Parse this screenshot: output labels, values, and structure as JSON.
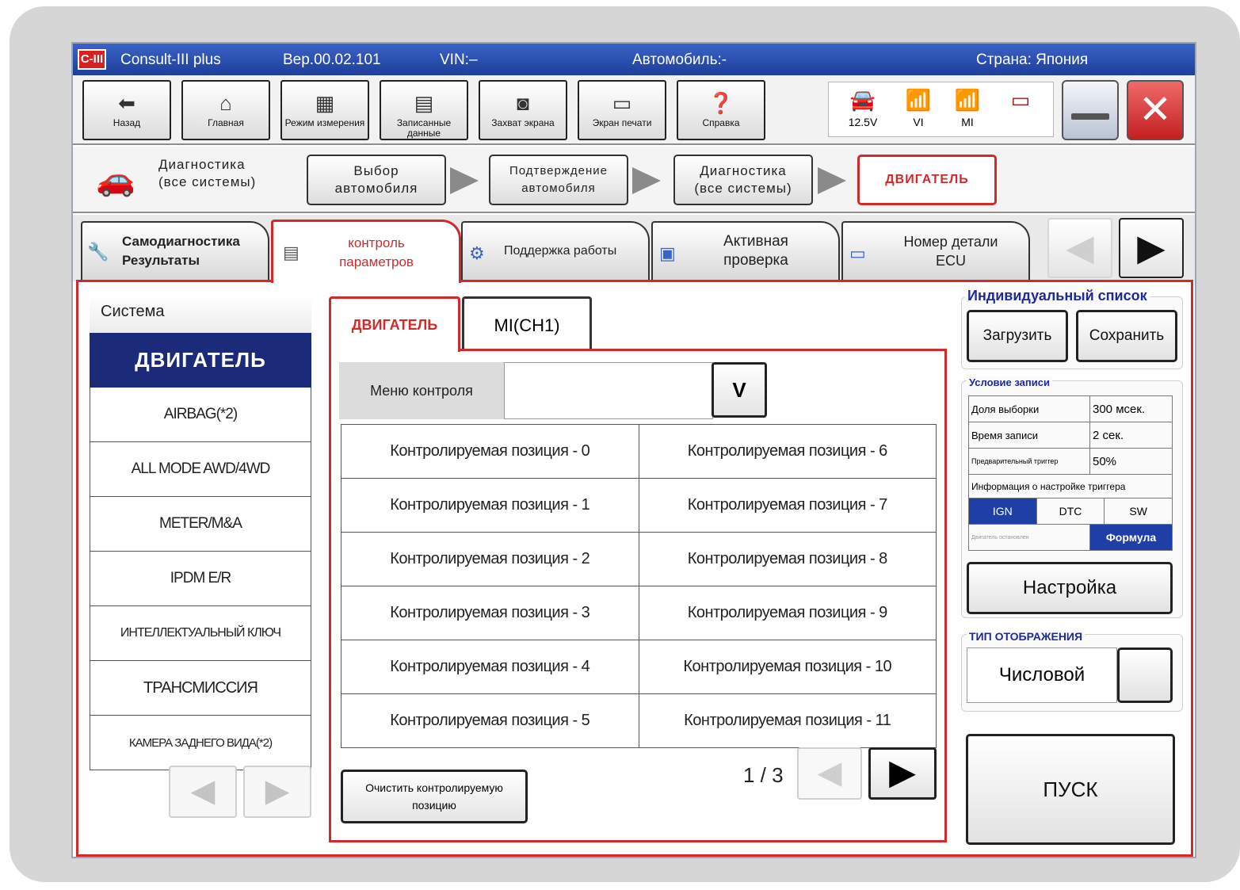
{
  "titlebar": {
    "logo": "C-III",
    "app": "Consult-III plus",
    "version": "Вер.00.02.101",
    "vin": "VIN:–",
    "vehicle": "Автомобиль:-",
    "country": "Страна: Япония"
  },
  "toolbar": {
    "buttons": [
      {
        "label": "Назад",
        "icon": "back-arrow-icon"
      },
      {
        "label": "Главная",
        "icon": "home-icon"
      },
      {
        "label": "Режим измерения",
        "icon": "measure-mode-icon"
      },
      {
        "label": "Записанные данные",
        "icon": "recorded-data-icon"
      },
      {
        "label": "Захват экрана",
        "icon": "camera-icon"
      },
      {
        "label": "Экран печати",
        "icon": "printer-icon"
      },
      {
        "label": "Справка",
        "icon": "help-icon"
      }
    ],
    "status": [
      {
        "label": "12.5V",
        "icon": "car-battery-icon"
      },
      {
        "label": "VI",
        "icon": "vi-signal-icon"
      },
      {
        "label": "MI",
        "icon": "mi-signal-icon"
      },
      {
        "label": "",
        "icon": "battery-icon"
      }
    ]
  },
  "breadcrumb": {
    "current_label": "Диагностика\n(все системы)",
    "steps": [
      "Выбор\nавтомобиля",
      "Подтверждение\nавтомобиля",
      "Диагностика\n(все системы)",
      "ДВИГАТЕЛЬ"
    ]
  },
  "tabs": [
    "Самодиагностика\nРезультаты",
    "контроль\nпараметров",
    "Поддержка работы",
    "Активная\nпроверка",
    "Номер детали\nECU"
  ],
  "system_panel": {
    "title": "Система",
    "items": [
      "ДВИГАТЕЛЬ",
      "AIRBAG(*2)",
      "ALL MODE AWD/4WD",
      "METER/M&A",
      "IPDM E/R",
      "ИНТЕЛЛЕКТУАЛЬНЫЙ КЛЮЧ",
      "ТРАНСМИССИЯ",
      "КАМЕРА ЗАДНЕГО ВИДА(*2)"
    ]
  },
  "monitor": {
    "tabs": [
      "ДВИГАТЕЛЬ",
      "MI(CH1)"
    ],
    "menu_label": "Меню контроля",
    "menu_value": "",
    "menu_dropdown": "V",
    "rows": [
      [
        "Контролируемая позиция - 0",
        "Контролируемая позиция - 6"
      ],
      [
        "Контролируемая позиция - 1",
        "Контролируемая позиция - 7"
      ],
      [
        "Контролируемая позиция - 2",
        "Контролируемая позиция - 8"
      ],
      [
        "Контролируемая позиция - 3",
        "Контролируемая позиция - 9"
      ],
      [
        "Контролируемая позиция - 4",
        "Контролируемая позиция - 10"
      ],
      [
        "Контролируемая позиция - 5",
        "Контролируемая позиция - 11"
      ]
    ],
    "clear_button": "Очистить контролируемую\nпозицию",
    "page": "1 / 3"
  },
  "right_panel": {
    "custom_list_title": "Индивидуальный список",
    "load": "Загрузить",
    "save": "Сохранить",
    "record_title": "Условие записи",
    "record_rows": [
      {
        "key": "Доля выборки",
        "value": "300 мсек."
      },
      {
        "key": "Время записи",
        "value": "2 сек."
      },
      {
        "key": "Предварительный триггер",
        "value": "50%"
      }
    ],
    "trigger_info": "Информация о настройке триггера",
    "trigger_options": [
      "IGN",
      "DTC",
      "SW"
    ],
    "trigger_selected": "IGN",
    "formula_left": "Двигатель остановлен",
    "formula_right": "Формула",
    "setup": "Настройка",
    "display_title": "ТИП ОТОБРАЖЕНИЯ",
    "display_value": "Числовой",
    "start": "ПУСК"
  },
  "colors": {
    "accent_red": "#d02a2a",
    "selected_blue": "#1c2a7a",
    "trigger_blue": "#1f3fa6",
    "title_blue": "#2a4fb8"
  }
}
